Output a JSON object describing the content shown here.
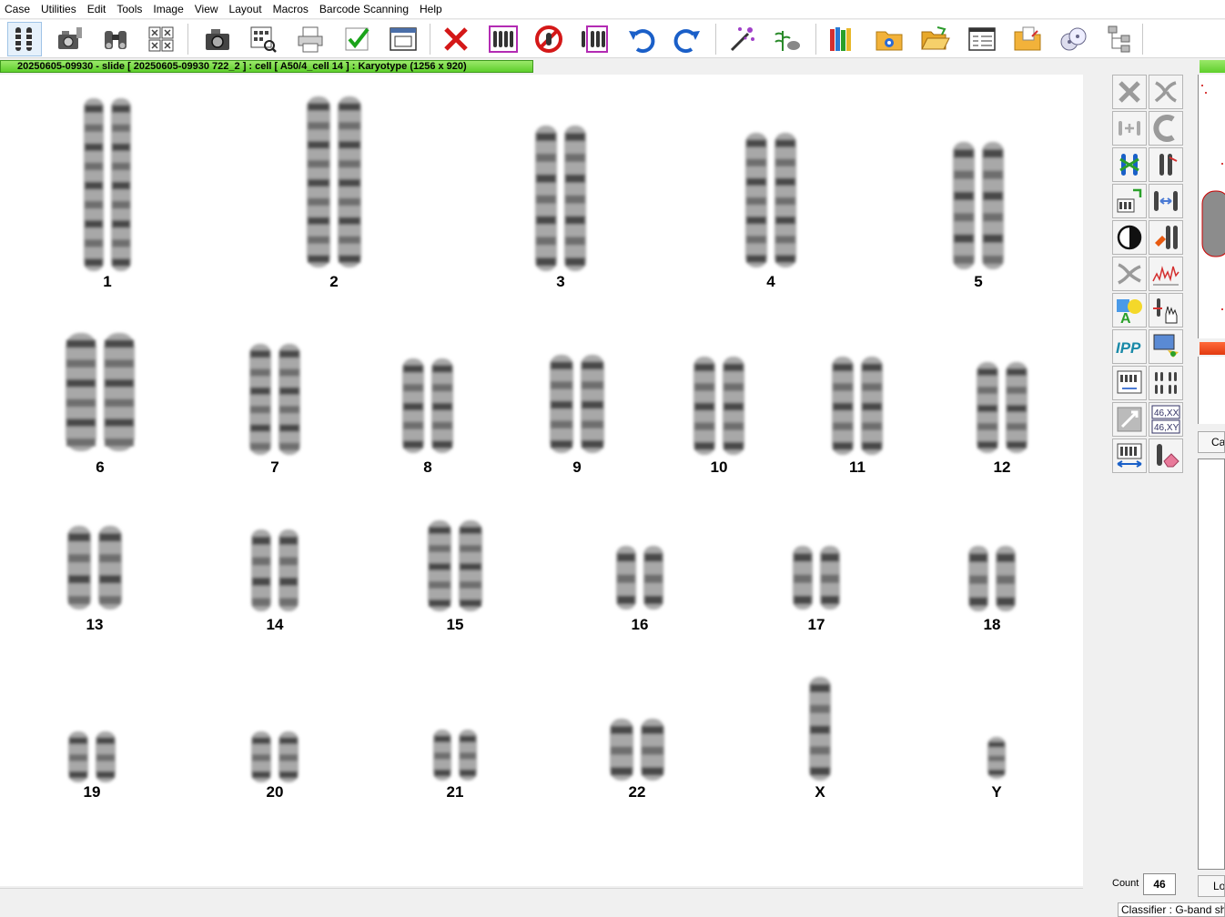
{
  "menu": [
    "Case",
    "Utilities",
    "Edit",
    "Tools",
    "Image",
    "View",
    "Layout",
    "Macros",
    "Barcode Scanning",
    "Help"
  ],
  "title": "20250605-09930 - slide [ 20250605-09930 722_2 ] : cell [ A50/4_cell 14 ] : Karyotype  (1256 x 920)",
  "toolbar_icons": [
    "karyotype-icon",
    "capture-icon",
    "binoculars-icon",
    "metaphase-grid-icon",
    "camera-icon",
    "inspect-icon",
    "printer-icon",
    "approve-check-icon",
    "window-icon",
    "delete-x-icon",
    "select-karyotype-icon",
    "cancel-icon",
    "karyotype-frame-icon",
    "undo-icon",
    "redo-icon",
    "magic-wand-icon",
    "plant-icon",
    "library-books-icon",
    "settings-folder-icon",
    "open-folder-icon",
    "list-view-icon",
    "export-folder-icon",
    "disks-icon",
    "tree-icon"
  ],
  "chromosomes": [
    "1",
    "2",
    "3",
    "4",
    "5",
    "6",
    "7",
    "8",
    "9",
    "10",
    "11",
    "12",
    "13",
    "14",
    "15",
    "16",
    "17",
    "18",
    "19",
    "20",
    "21",
    "22",
    "X",
    "Y"
  ],
  "palette_icons": [
    "delete-icon",
    "cut-icon",
    "join-icon",
    "bend-icon",
    "swap-icon",
    "split-icon",
    "rotate-icon",
    "align-icon",
    "contrast-icon",
    "color-icon",
    "separate-icon",
    "profile-icon",
    "annotate-icon",
    "hand-icon",
    "ipp-icon",
    "screen-icon",
    "karyogram-icon",
    "arrange-icon",
    "crop-icon",
    "sex-icon",
    "layout-arrows-icon",
    "erase-icon"
  ],
  "palette_labels": {
    "ipp": "IPP",
    "sex_top": "46,XX",
    "sex_bottom": "46,XY"
  },
  "side": {
    "ca": "Ca",
    "lo": "Lo"
  },
  "count": {
    "label": "Count",
    "value": "46"
  },
  "status": "Classifier : G-band sho"
}
